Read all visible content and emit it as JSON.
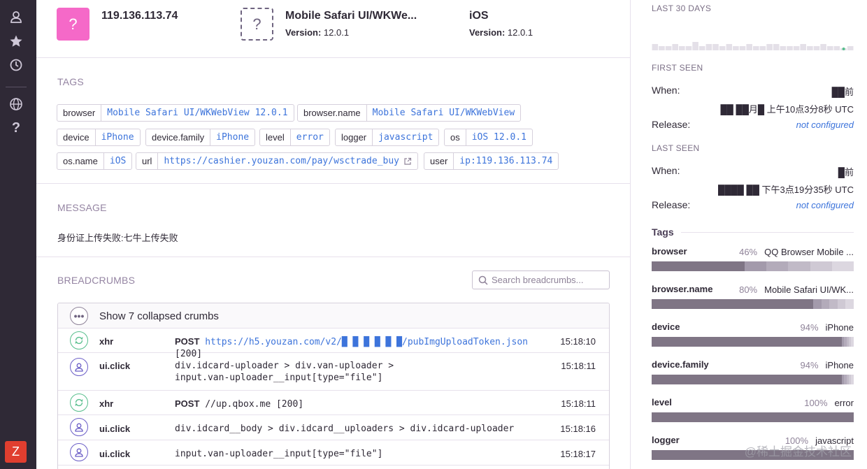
{
  "header": {
    "ip": "119.136.113.74",
    "browser_name": "Mobile Safari UI/WKWe...",
    "browser_version_label": "Version:",
    "browser_version": "12.0.1",
    "os_name": "iOS",
    "os_version_label": "Version:",
    "os_version": "12.0.1",
    "user_avatar_glyph": "?",
    "browser_icon_glyph": "?"
  },
  "tags": {
    "title": "TAGS",
    "items": [
      {
        "key": "browser",
        "value": "Mobile Safari UI/WKWebView 12.0.1"
      },
      {
        "key": "browser.name",
        "value": "Mobile Safari UI/WKWebView"
      },
      {
        "key": "device",
        "value": "iPhone"
      },
      {
        "key": "device.family",
        "value": "iPhone"
      },
      {
        "key": "level",
        "value": "error"
      },
      {
        "key": "logger",
        "value": "javascript"
      },
      {
        "key": "os",
        "value": "iOS 12.0.1"
      },
      {
        "key": "os.name",
        "value": "iOS"
      },
      {
        "key": "url",
        "value": "https://cashier.youzan.com/pay/wsctrade_buy"
      },
      {
        "key": "user",
        "value": "ip:119.136.113.74"
      }
    ]
  },
  "message": {
    "title": "MESSAGE",
    "text": "身份证上传失败:七牛上传失败"
  },
  "breadcrumbs": {
    "title": "BREADCRUMBS",
    "search_placeholder": "Search breadcrumbs...",
    "collapsed_label": "Show 7 collapsed crumbs",
    "rows": [
      {
        "type": "xhr",
        "category": "xhr",
        "method": "POST",
        "message": "https://h5.youzan.com/v2/█ █ █ █ █ █/pubImgUploadToken.json",
        "status": "[200]",
        "time": "15:18:10"
      },
      {
        "type": "click",
        "category": "ui.click",
        "method": "",
        "message": "div.idcard-uploader > div.van-uploader > input.van-uploader__input[type=\"file\"]",
        "status": "",
        "time": "15:18:11"
      },
      {
        "type": "xhr",
        "category": "xhr",
        "method": "POST",
        "message": "//up.qbox.me",
        "status": "[200]",
        "time": "15:18:11"
      },
      {
        "type": "click",
        "category": "ui.click",
        "method": "",
        "message": "div.idcard__body > div.idcard__uploaders > div.idcard-uploader",
        "status": "",
        "time": "15:18:16"
      },
      {
        "type": "click",
        "category": "ui.click",
        "method": "",
        "message": "input.van-uploader__input[type=\"file\"]",
        "status": "",
        "time": "15:18:17"
      }
    ]
  },
  "sidebar": {
    "last30_title": "LAST 30 DAYS",
    "sparkline": [
      2,
      1,
      1,
      2,
      1,
      1,
      3,
      1,
      2,
      2,
      1,
      2,
      1,
      1,
      2,
      1,
      1,
      2,
      2,
      1,
      1,
      1,
      2,
      1,
      1,
      2,
      1,
      1,
      0,
      1
    ],
    "first_seen": {
      "title": "FIRST SEEN",
      "when_label": "When:",
      "when_relative": "██前",
      "when_absolute": "██ ██月█ 上午10点3分8秒 UTC",
      "release_label": "Release:",
      "release_value": "not configured"
    },
    "last_seen": {
      "title": "LAST SEEN",
      "when_label": "When:",
      "when_relative": "█前",
      "when_absolute": "████ ██ 下午3点19分35秒 UTC",
      "release_label": "Release:",
      "release_value": "not configured"
    },
    "tags_title": "Tags",
    "tag_stats": [
      {
        "name": "browser",
        "pct": "46%",
        "top": "QQ Browser Mobile ...",
        "share": 0.46
      },
      {
        "name": "browser.name",
        "pct": "80%",
        "top": "Mobile Safari UI/WK...",
        "share": 0.8
      },
      {
        "name": "device",
        "pct": "94%",
        "top": "iPhone",
        "share": 0.94
      },
      {
        "name": "device.family",
        "pct": "94%",
        "top": "iPhone",
        "share": 0.94
      },
      {
        "name": "level",
        "pct": "100%",
        "top": "error",
        "share": 1.0
      },
      {
        "name": "logger",
        "pct": "100%",
        "top": "javascript",
        "share": 1.0
      }
    ]
  },
  "nav": {
    "bottom_badge": "Z"
  },
  "watermark": "@稀土掘金技术社区",
  "colors": {
    "accent": "#f569c8",
    "link": "#3d74db",
    "nav_bg": "#2f2936",
    "bar": "#7f7585",
    "xhr": "#57be8c",
    "click": "#6c5fc7"
  }
}
